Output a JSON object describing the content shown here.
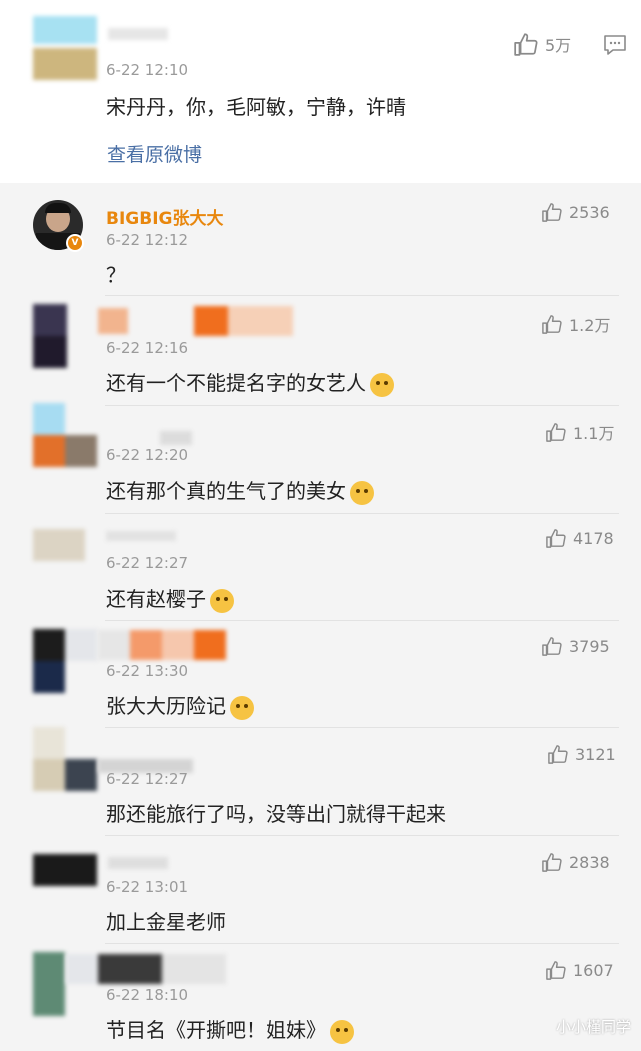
{
  "main_comment": {
    "time": "6-22 12:10",
    "text": "宋丹丹，你，毛阿敏，宁静，许晴",
    "like_count": "5万",
    "view_original_link": "查看原微博"
  },
  "replies": [
    {
      "name": "BIGBIG张大大",
      "time": "6-22 12:12",
      "text": "？",
      "likes": "2536",
      "verified_badge": "V"
    },
    {
      "name": "",
      "time": "6-22 12:16",
      "text": "还有一个不能提名字的女艺人",
      "likes": "1.2万",
      "emoji": "doge-emoji"
    },
    {
      "name": "",
      "time": "6-22 12:20",
      "text": "还有那个真的生气了的美女",
      "likes": "1.1万",
      "emoji": "doge-emoji"
    },
    {
      "name": "",
      "time": "6-22 12:27",
      "text": "还有赵樱子",
      "likes": "4178",
      "emoji": "party-emoji"
    },
    {
      "name": "",
      "time": "6-22 13:30",
      "text": "张大大历险记",
      "likes": "3795",
      "emoji": "laugh-cry-emoji"
    },
    {
      "name": "",
      "time": "6-22 12:27",
      "text": "那还能旅行了吗，没等出门就得干起来",
      "likes": "3121"
    },
    {
      "name": "",
      "time": "6-22 13:01",
      "text": "加上金星老师",
      "likes": "2838"
    },
    {
      "name": "",
      "time": "6-22 18:10",
      "text": "节目名《开撕吧！姐妹》",
      "likes": "1607",
      "emoji": "doge-emoji"
    }
  ],
  "watermark": "小小槿同学",
  "colors": {
    "name_orange": "#e8870e",
    "link_blue": "#4a6fa5",
    "time_gray": "#9a9a9a",
    "reply_bg": "#f4f4f4"
  }
}
